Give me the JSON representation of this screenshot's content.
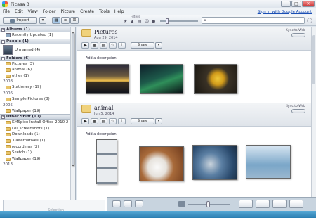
{
  "window": {
    "title": "Picasa 3"
  },
  "menu": [
    "File",
    "Edit",
    "View",
    "Folder",
    "Picture",
    "Create",
    "Tools",
    "Help"
  ],
  "signin": "Sign in with Google Account",
  "toolbar": {
    "import_label": "Import",
    "filters_label": "Filters"
  },
  "search": {
    "placeholder": "",
    "icon": "search-icon"
  },
  "sidebar": {
    "albums": {
      "title": "Albums (1)",
      "items": [
        "Recently Updated (1)"
      ]
    },
    "people": {
      "title": "People (1)",
      "items": [
        "Unnamed (4)"
      ]
    },
    "folders": {
      "title": "Folders (6)",
      "groups": [
        {
          "year": "",
          "items": [
            "Pictures (3)",
            "animal (6)",
            "other (1)"
          ]
        },
        {
          "year": "2008",
          "items": [
            "Stationery (19)"
          ]
        },
        {
          "year": "2006",
          "items": [
            "Sample Pictures (8)"
          ]
        },
        {
          "year": "2005",
          "items": [
            "Wallpaper (19)"
          ]
        }
      ]
    },
    "other": {
      "title": "Other Stuff (10)",
      "items": [
        "KMSpico Install Office 2010 2 ...",
        "Lol_screenshots (1)",
        "Downloads (1)",
        "3 alternatives (1)",
        "recordings (2)",
        "Sketch (1)",
        "Wallpaper (19)"
      ],
      "year_tail": "2013"
    }
  },
  "albums": [
    {
      "name": "Pictures",
      "date": "Aug 29, 2014",
      "sync_label": "Sync to Web",
      "share_label": "Share",
      "desc": "Add a description"
    },
    {
      "name": "animal",
      "date": "Jun 5, 2014",
      "sync_label": "Sync to Web",
      "share_label": "Share",
      "desc": "Add a description"
    }
  ],
  "bottom": {
    "selection_label": "Selection"
  },
  "colors": {
    "folder": "#e8c46a",
    "accent_blue": "#2a7db0",
    "header": "#dfe4ea"
  }
}
